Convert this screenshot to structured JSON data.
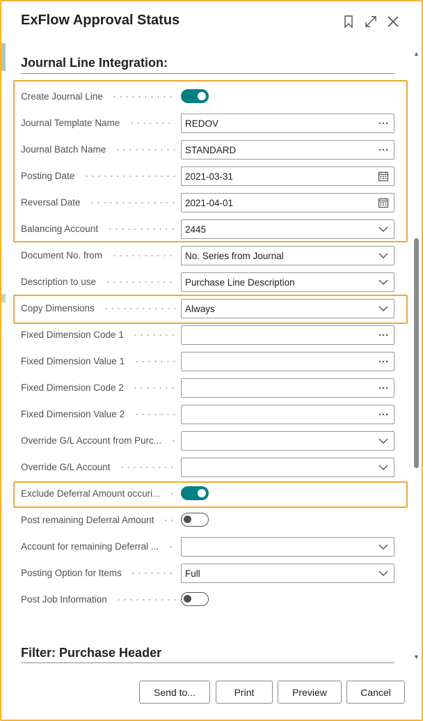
{
  "window": {
    "title": "ExFlow Approval Status",
    "icons": [
      "bookmark-icon",
      "expand-icon",
      "close-icon"
    ]
  },
  "sections": {
    "journal": "Journal Line Integration:",
    "filter": "Filter: Purchase Header"
  },
  "fields": [
    {
      "label": "Create Journal Line",
      "type": "toggle",
      "on": true
    },
    {
      "label": "Journal Template Name",
      "type": "lookup",
      "value": "REDOV"
    },
    {
      "label": "Journal Batch Name",
      "type": "lookup",
      "value": "STANDARD"
    },
    {
      "label": "Posting Date",
      "type": "date",
      "value": "2021-03-31"
    },
    {
      "label": "Reversal Date",
      "type": "date",
      "value": "2021-04-01"
    },
    {
      "label": "Balancing Account",
      "type": "dropdown",
      "value": "2445"
    },
    {
      "label": "Document No. from",
      "type": "dropdown",
      "value": "No. Series from Journal"
    },
    {
      "label": "Description to use",
      "type": "dropdown",
      "value": "Purchase Line Description"
    },
    {
      "label": "Copy Dimensions",
      "type": "dropdown",
      "value": "Always"
    },
    {
      "label": "Fixed Dimension Code 1",
      "type": "lookup",
      "value": ""
    },
    {
      "label": "Fixed Dimension Value 1",
      "type": "lookup",
      "value": ""
    },
    {
      "label": "Fixed Dimension Code 2",
      "type": "lookup",
      "value": ""
    },
    {
      "label": "Fixed Dimension Value 2",
      "type": "lookup",
      "value": ""
    },
    {
      "label": "Override G/L Account from Purc...",
      "type": "dropdown",
      "value": ""
    },
    {
      "label": "Override G/L Account",
      "type": "dropdown",
      "value": ""
    },
    {
      "label": "Exclude Deferral Amount occuri...",
      "type": "toggle",
      "on": true
    },
    {
      "label": "Post remaining Deferral Amount",
      "type": "toggle",
      "on": false
    },
    {
      "label": "Account for remaining Deferral ...",
      "type": "dropdown",
      "value": ""
    },
    {
      "label": "Posting Option for Items",
      "type": "dropdown",
      "value": "Full"
    },
    {
      "label": "Post Job Information",
      "type": "toggle",
      "on": false
    }
  ],
  "buttons": {
    "send_to": "Send to...",
    "print": "Print",
    "preview": "Preview",
    "cancel": "Cancel"
  },
  "colors": {
    "highlight": "#f0a92e",
    "toggle_on": "#008080"
  }
}
